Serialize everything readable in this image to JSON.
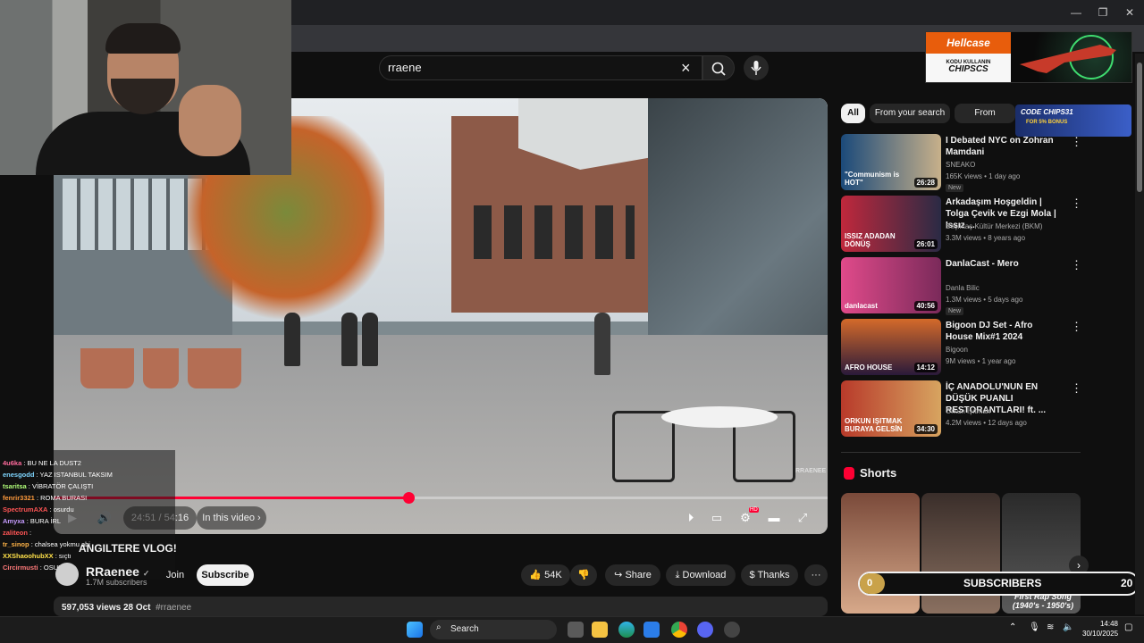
{
  "browser": {
    "window_controls": [
      "—",
      "❐",
      "✕"
    ]
  },
  "search": {
    "value": "rraene",
    "clear_icon": "×",
    "icon": "search-icon",
    "mic_icon": "mic-icon"
  },
  "player": {
    "time": "24:51 / 54:16",
    "chapter": "In this video",
    "progress": 0.458,
    "controls": [
      "play-icon",
      "volume-icon",
      "autoplay-icon",
      "subtitles-icon",
      "settings-icon",
      "theater-icon",
      "fullscreen-icon"
    ],
    "hd_badge": "HD",
    "watermark": "RRAENEE"
  },
  "webcam": {},
  "chat": {
    "title": "ANGILTERE VLOG!",
    "messages": [
      {
        "user": "4u6ka",
        "text": ": BU NE LA DUST2",
        "color": "#ff6b9d"
      },
      {
        "user": "enesgodd",
        "text": ": YAZ ISTANBUL TAKSIM",
        "color": "#7fd6ff"
      },
      {
        "user": "tsaritsa",
        "text": ": VİBRATÖR ÇALIŞTI",
        "color": "#b2ff7a"
      },
      {
        "user": "fenrir3321",
        "text": ": ROMA BURASI",
        "color": "#ff9b3d"
      },
      {
        "user": "SpectrumAXA",
        "text": ": osurdu",
        "color": "#ff5555"
      },
      {
        "user": "Amyxa",
        "text": ": BURA İRL",
        "color": "#c69cff"
      },
      {
        "user": "zaliteon",
        "text": ":",
        "color": "#ff5555"
      },
      {
        "user": "tr_sinop",
        "text": ": chalsea yokmu abi",
        "color": "#ffb347"
      },
      {
        "user": "XXShaoohubXX",
        "text": ": sıçtı",
        "color": "#ffe14a"
      },
      {
        "user": "Circirmusti",
        "text": ": OSURDU",
        "color": "#ff7a7a"
      }
    ]
  },
  "channel": {
    "name": "RRaenee",
    "verified": "✓",
    "subscribers": "1.7M subscribers",
    "join": "Join",
    "subscribe": "Subscribe"
  },
  "actions": {
    "likes": "54K",
    "share": "Share",
    "download": "Download",
    "thanks": "Thanks",
    "more": "···"
  },
  "description": {
    "views_date": "597,053 views  28 Oct",
    "tag": "#rraenee"
  },
  "sidebar": {
    "chips": [
      "All",
      "From your search",
      "From RRaenee"
    ],
    "videos": [
      {
        "title": "I Debated NYC on Zohran Mamdani",
        "channel": "SNEAKO",
        "meta": "165K views • 1 day ago",
        "badge": "New",
        "duration": "26:28",
        "thumb_caption": "\"Communism is HOT\""
      },
      {
        "title": "Arkadaşım Hoşgeldin | Tolga Çevik ve Ezgi Mola | Issız ...",
        "channel": "Beşiktaş Kültür Merkezi (BKM)",
        "meta": "3.3M views • 8 years ago",
        "badge": "",
        "duration": "26:01",
        "thumb_caption": "ISSIZ ADADAN DÖNÜŞ"
      },
      {
        "title": "DanlaCast - Mero",
        "channel": "Danla Bilic",
        "meta": "1.3M views • 5 days ago",
        "badge": "New",
        "duration": "40:56",
        "thumb_caption": "danlacast"
      },
      {
        "title": "Bigoon DJ Set - Afro House Mix#1 2024",
        "channel": "Bigoon",
        "meta": "9M views • 1 year ago",
        "badge": "",
        "duration": "14:12",
        "thumb_caption": "AFRO HOUSE"
      },
      {
        "title": "İÇ ANADOLU'NUN EN DÜŞÜK PUANLI RESTORANTLARI! ft. ...",
        "channel": "Orkun Işıtmak",
        "meta": "4.2M views • 12 days ago",
        "badge": "",
        "duration": "34:30",
        "thumb_caption": "ORKUN IŞITMAK BURAYA GELSİN"
      }
    ],
    "shorts_label": "Shorts",
    "shorts_caption": "First Rap Song (1940's - 1950's)"
  },
  "ads": {
    "top_brand": "Hellcase",
    "top_line1": "KODU KULLANIN",
    "top_code": "CHIPSCS",
    "mini_code": "CODE CHIPS31",
    "mini_bonus": "FOR 5% BONUS"
  },
  "sub_goal": {
    "current": "0",
    "label": "SUBSCRIBERS",
    "goal": "20"
  },
  "taskbar": {
    "search": "Search",
    "time": "14:48",
    "date": "30/10/2025"
  }
}
